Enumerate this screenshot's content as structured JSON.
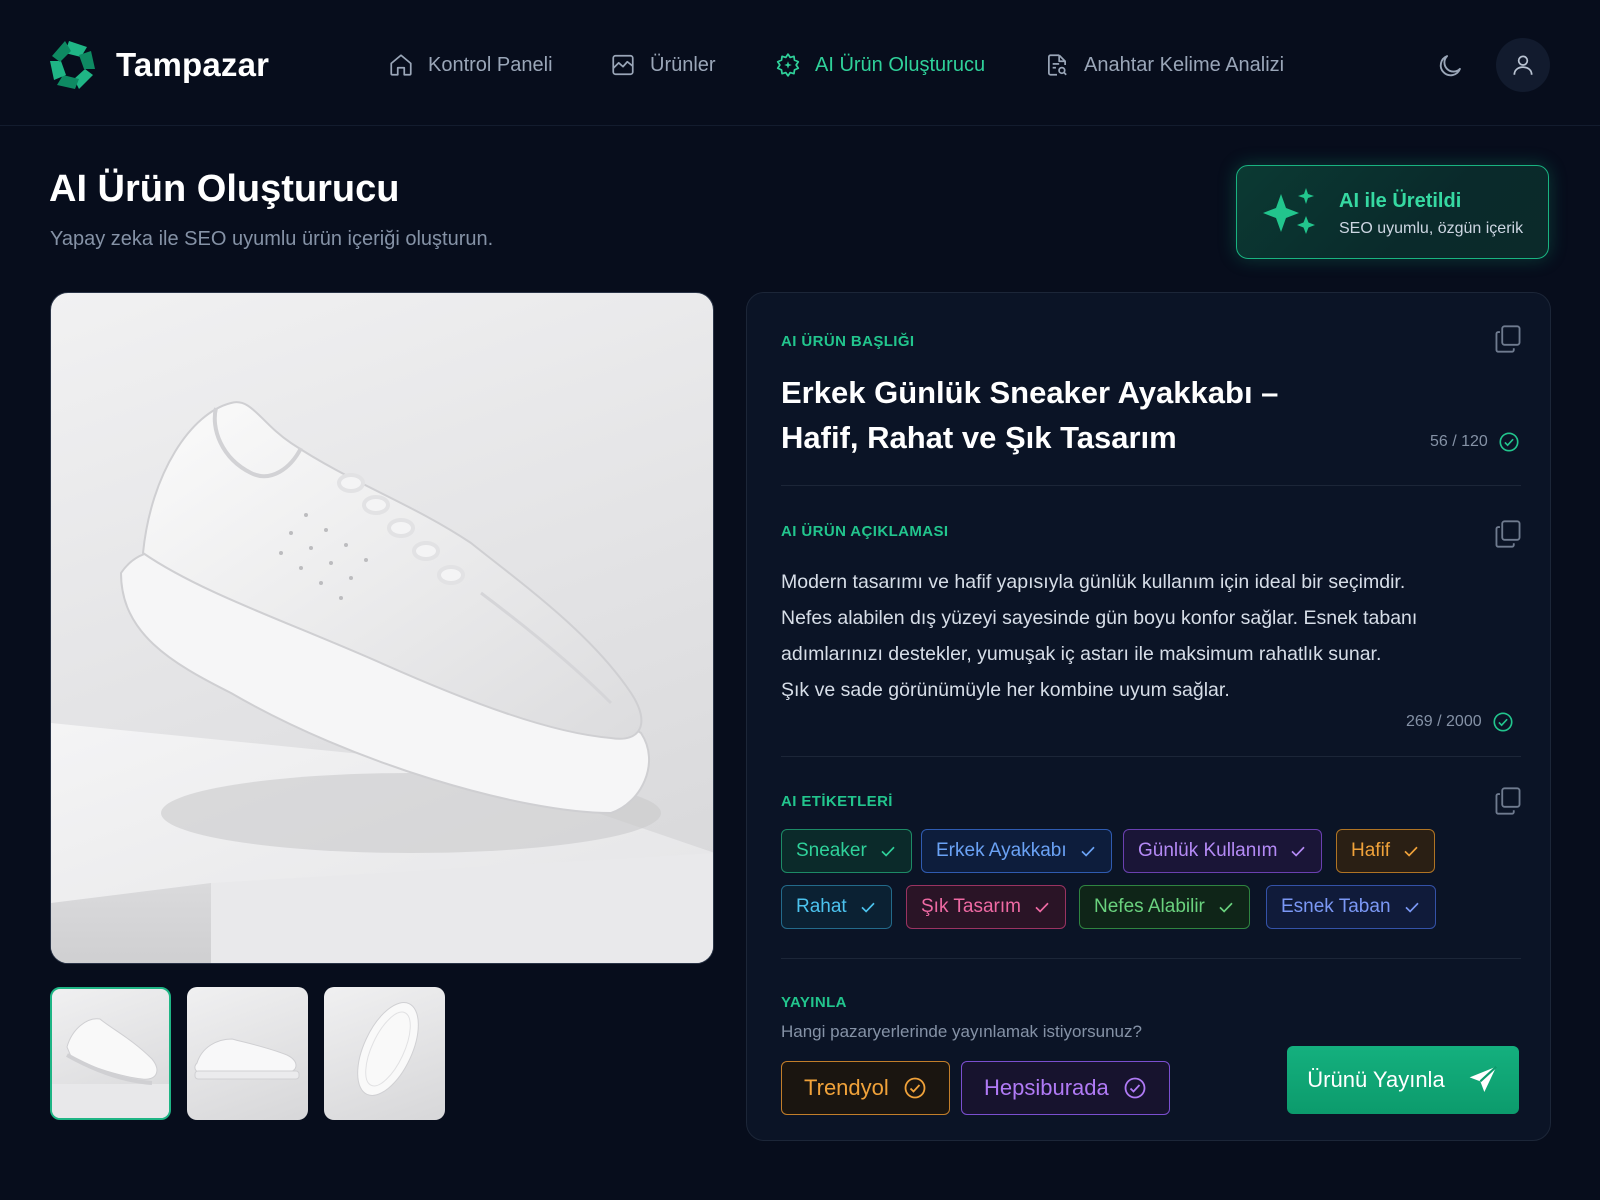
{
  "brand": {
    "name": "Tampazar"
  },
  "nav": {
    "items": [
      {
        "label": "Kontrol Paneli",
        "icon": "home-icon",
        "active": false
      },
      {
        "label": "Ürünler",
        "icon": "image-chart-icon",
        "active": false
      },
      {
        "label": "AI Ürün Oluşturucu",
        "icon": "ai-gear-icon",
        "active": true
      },
      {
        "label": "Anahtar Kelime Analizi",
        "icon": "document-search-icon",
        "active": false
      }
    ],
    "theme_toggle_icon": "moon-icon",
    "profile_icon": "user-icon"
  },
  "header": {
    "title": "AI Ürün Oluşturucu",
    "subtitle": "Yapay zeka ile SEO uyumlu ürün içeriği oluşturun."
  },
  "ai_badge": {
    "title": "AI ile Üretildi",
    "subtitle": "SEO uyumlu, özgün içerik",
    "icon": "sparkles-icon"
  },
  "gallery": {
    "selected_index": 0,
    "thumbnails": [
      "sneaker-angled",
      "sneaker-side",
      "sneaker-sole"
    ]
  },
  "product_title": {
    "label": "AI ÜRÜN BAŞLIĞI",
    "line1": "Erkek Günlük Sneaker Ayakkabı –",
    "line2": "Hafif, Rahat ve Şık Tasarım",
    "counter": "56 / 120"
  },
  "product_description": {
    "label": "AI ÜRÜN AÇIKLAMASI",
    "lines": [
      "Modern tasarımı ve hafif yapısıyla günlük kullanım için ideal bir seçimdir.",
      "Nefes alabilen dış yüzeyi sayesinde gün boyu konfor sağlar. Esnek tabanı",
      "adımlarınızı destekler, yumuşak iç astarı ile maksimum rahatlık sunar.",
      "Şık ve sade görünümüyle her kombine uyum sağlar."
    ],
    "counter": "269 / 2000"
  },
  "tags": {
    "label": "AI ETİKETLERİ",
    "items": [
      {
        "text": "Sneaker",
        "color": "#2fd19a"
      },
      {
        "text": "Erkek Ayakkabı",
        "color": "#4f8cf0"
      },
      {
        "text": "Günlük Kullanım",
        "color": "#a46cf2"
      },
      {
        "text": "Hafif",
        "color": "#f0a23a"
      },
      {
        "text": "Rahat",
        "color": "#3bb8e6"
      },
      {
        "text": "Şık Tasarım",
        "color": "#ec5b9a"
      },
      {
        "text": "Nefes Alabilir",
        "color": "#4cc765"
      },
      {
        "text": "Esnek Taban",
        "color": "#5d7ff0"
      }
    ]
  },
  "publish": {
    "label": "YAYINLA",
    "question": "Hangi pazaryerlerinde yayınlamak istiyorsunuz?",
    "markets": [
      {
        "name": "Trendyol",
        "color": "#f0a23a"
      },
      {
        "name": "Hepsiburada",
        "color": "#b07af5"
      }
    ],
    "button_label": "Ürünü Yayınla"
  }
}
